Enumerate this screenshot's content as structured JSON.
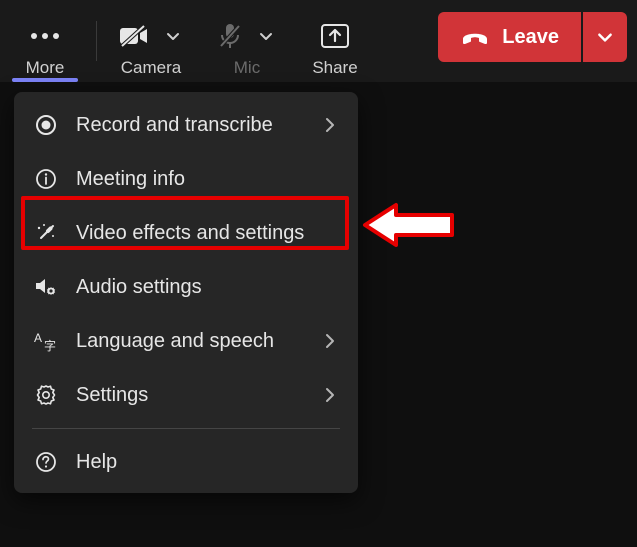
{
  "toolbar": {
    "more_label": "More",
    "camera_label": "Camera",
    "mic_label": "Mic",
    "share_label": "Share",
    "leave_label": "Leave"
  },
  "menu": {
    "record": "Record and transcribe",
    "info": "Meeting info",
    "video_effects": "Video effects and settings",
    "audio": "Audio settings",
    "language": "Language and speech",
    "settings": "Settings",
    "help": "Help"
  }
}
